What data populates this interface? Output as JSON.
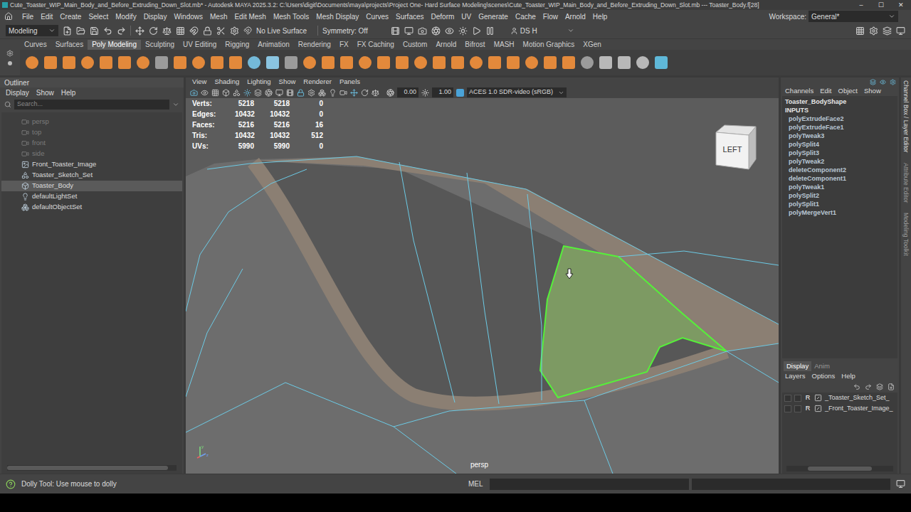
{
  "window": {
    "title": "Cute_Toaster_WIP_Main_Body_and_Before_Extruding_Down_Slot.mb* - Autodesk MAYA 2025.3.2: C:\\Users\\digit\\Documents\\maya\\projects\\Project One- Hard Surface Modeling\\scenes\\Cute_Toaster_WIP_Main_Body_and_Before_Extruding_Down_Slot.mb  ---  Toaster_Body.f[28]",
    "controls": [
      "–",
      "☐",
      "✕"
    ]
  },
  "menu": [
    "File",
    "Edit",
    "Create",
    "Select",
    "Modify",
    "Display",
    "Windows",
    "Mesh",
    "Edit Mesh",
    "Mesh Tools",
    "Mesh Display",
    "Curves",
    "Surfaces",
    "Deform",
    "UV",
    "Generate",
    "Cache",
    "Flow",
    "Arnold",
    "Help"
  ],
  "workspace": {
    "label": "Workspace:",
    "value": "General*"
  },
  "status_line": {
    "mode": "Modeling",
    "live_surface": "No Live Surface",
    "symmetry": "Symmetry: Off",
    "user": "DS H"
  },
  "shelf_tabs": [
    {
      "label": "Curves",
      "selected": false
    },
    {
      "label": "Surfaces",
      "selected": false
    },
    {
      "label": "Poly Modeling",
      "selected": true
    },
    {
      "label": "Sculpting",
      "selected": false
    },
    {
      "label": "UV Editing",
      "selected": false
    },
    {
      "label": "Rigging",
      "selected": false
    },
    {
      "label": "Animation",
      "selected": false
    },
    {
      "label": "Rendering",
      "selected": false
    },
    {
      "label": "FX",
      "selected": false
    },
    {
      "label": "FX Caching",
      "selected": false
    },
    {
      "label": "Custom",
      "selected": false
    },
    {
      "label": "Arnold",
      "selected": false
    },
    {
      "label": "Bifrost",
      "selected": false
    },
    {
      "label": "MASH",
      "selected": false
    },
    {
      "label": "Motion Graphics",
      "selected": false
    },
    {
      "label": "XGen",
      "selected": false
    }
  ],
  "outliner": {
    "title": "Outliner",
    "menu": [
      "Display",
      "Show",
      "Help"
    ],
    "search_placeholder": "Search...",
    "items": [
      {
        "label": "persp",
        "kind": "camera",
        "dimmed": true,
        "selected": false
      },
      {
        "label": "top",
        "kind": "camera",
        "dimmed": true,
        "selected": false
      },
      {
        "label": "front",
        "kind": "camera",
        "dimmed": true,
        "selected": false
      },
      {
        "label": "side",
        "kind": "camera",
        "dimmed": true,
        "selected": false
      },
      {
        "label": "Front_Toaster_Image",
        "kind": "image",
        "dimmed": false,
        "selected": false
      },
      {
        "label": "Toaster_Sketch_Set",
        "kind": "set",
        "dimmed": false,
        "selected": false
      },
      {
        "label": "Toaster_Body",
        "kind": "mesh",
        "dimmed": false,
        "selected": true
      },
      {
        "label": "defaultLightSet",
        "kind": "lightset",
        "dimmed": false,
        "selected": false
      },
      {
        "label": "defaultObjectSet",
        "kind": "objectset",
        "dimmed": false,
        "selected": false
      }
    ]
  },
  "viewport": {
    "menu": [
      "View",
      "Shading",
      "Lighting",
      "Show",
      "Renderer",
      "Panels"
    ],
    "exposure": "0.00",
    "gamma": "1.00",
    "color_space": "ACES 1.0 SDR-video (sRGB)",
    "hud": [
      {
        "label": "Verts:",
        "values": [
          "5218",
          "5218",
          "0"
        ]
      },
      {
        "label": "Edges:",
        "values": [
          "10432",
          "10432",
          "0"
        ]
      },
      {
        "label": "Faces:",
        "values": [
          "5216",
          "5216",
          "16"
        ]
      },
      {
        "label": "Tris:",
        "values": [
          "10432",
          "10432",
          "512"
        ]
      },
      {
        "label": "UVs:",
        "values": [
          "5990",
          "5990",
          "0"
        ]
      }
    ],
    "view_cube": "LEFT",
    "camera": "persp",
    "axes": [
      "y",
      "z"
    ]
  },
  "channel_box": {
    "menu": [
      "Channels",
      "Edit",
      "Object",
      "Show"
    ],
    "shape": "Toaster_BodyShape",
    "inputs_label": "INPUTS",
    "inputs": [
      "polyExtrudeFace2",
      "polyExtrudeFace1",
      "polyTweak3",
      "polySplit4",
      "polySplit3",
      "polyTweak2",
      "deleteComponent2",
      "deleteComponent1",
      "polyTweak1",
      "polySplit2",
      "polySplit1",
      "polyMergeVert1"
    ]
  },
  "layer_editor": {
    "tabs": [
      {
        "label": "Display",
        "selected": true
      },
      {
        "label": "Anim",
        "selected": false
      }
    ],
    "menu": [
      "Layers",
      "Options",
      "Help"
    ],
    "layers": [
      {
        "flag": "R",
        "name": "_Toaster_Sketch_Set_"
      },
      {
        "flag": "R",
        "name": "_Front_Toaster_Image_"
      }
    ]
  },
  "side_tabs": [
    "Channel Box / Layer Editor",
    "Attribute Editor",
    "Modeling Toolkit"
  ],
  "help_line": "Dolly Tool: Use mouse to dolly",
  "command_line": {
    "language": "MEL"
  }
}
